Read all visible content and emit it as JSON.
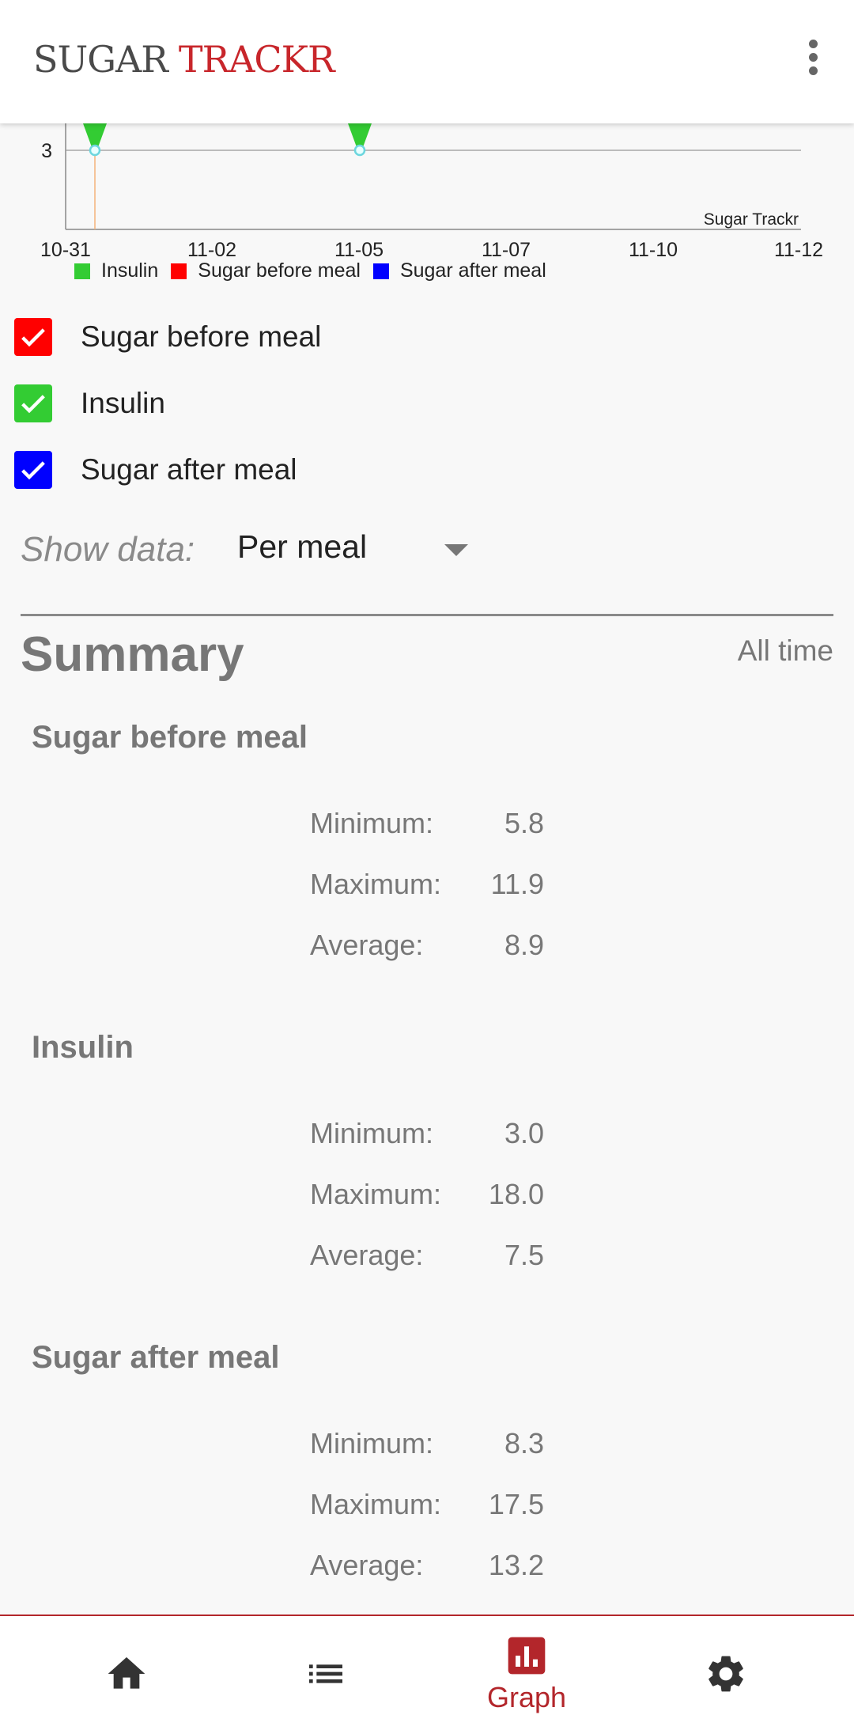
{
  "app": {
    "logo_part1": "SUGAR",
    "logo_part2": "TRACKR",
    "menu_icon": "more-vert-icon"
  },
  "chart_data": {
    "type": "line",
    "x_ticks": [
      "10-31",
      "11-02",
      "11-05",
      "11-07",
      "11-10",
      "11-12"
    ],
    "y_ticks": [
      "3"
    ],
    "watermark": "Sugar Trackr",
    "series": [
      {
        "name": "Insulin",
        "color": "#33cc33"
      },
      {
        "name": "Sugar before meal",
        "color": "#ff0000"
      },
      {
        "name": "Sugar after meal",
        "color": "#0000ff"
      }
    ],
    "visible_points": [
      {
        "series": "Insulin",
        "x": "10-31",
        "y": 3
      },
      {
        "series": "Insulin",
        "x": "11-05",
        "y": 3
      }
    ]
  },
  "checkboxes": [
    {
      "label": "Sugar before meal",
      "checked": true,
      "color": "#ff0000"
    },
    {
      "label": "Insulin",
      "checked": true,
      "color": "#33cc33"
    },
    {
      "label": "Sugar after meal",
      "checked": true,
      "color": "#0000ff"
    }
  ],
  "show_data": {
    "label": "Show data:",
    "value": "Per meal"
  },
  "summary": {
    "title": "Summary",
    "range": "All time",
    "sections": [
      {
        "title": "Sugar before meal",
        "min_label": "Minimum:",
        "min": "5.8",
        "max_label": "Maximum:",
        "max": "11.9",
        "avg_label": "Average:",
        "avg": "8.9"
      },
      {
        "title": "Insulin",
        "min_label": "Minimum:",
        "min": "3.0",
        "max_label": "Maximum:",
        "max": "18.0",
        "avg_label": "Average:",
        "avg": "7.5"
      },
      {
        "title": "Sugar after meal",
        "min_label": "Minimum:",
        "min": "8.3",
        "max_label": "Maximum:",
        "max": "17.5",
        "avg_label": "Average:",
        "avg": "13.2"
      }
    ]
  },
  "bottom_nav": {
    "items": [
      {
        "icon": "home-icon",
        "active": false
      },
      {
        "icon": "list-icon",
        "active": false
      },
      {
        "icon": "graph-icon",
        "label": "Graph",
        "active": true
      },
      {
        "icon": "gear-icon",
        "active": false
      }
    ],
    "accent": "#b3262b"
  }
}
